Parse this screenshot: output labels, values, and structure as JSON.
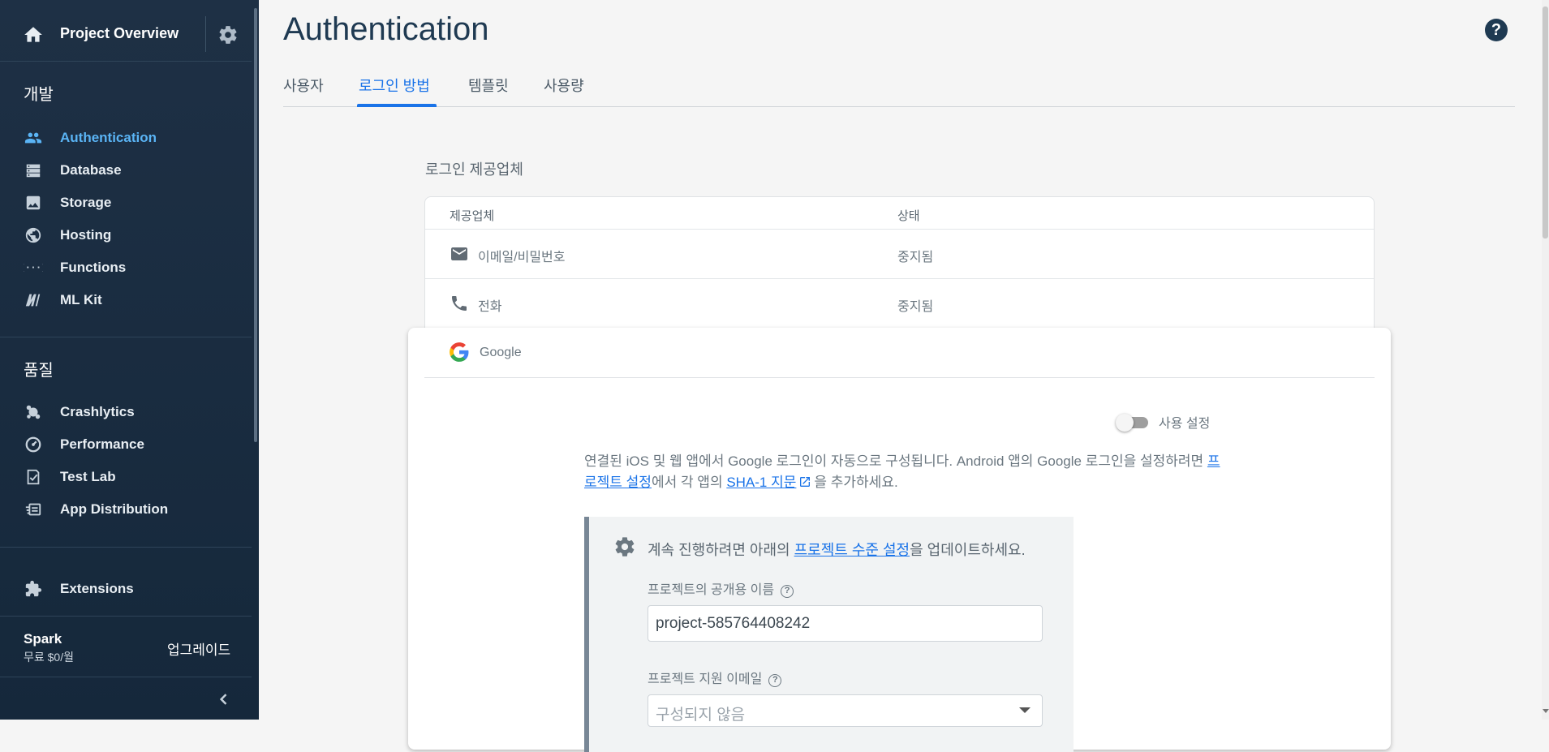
{
  "sidebar": {
    "project": "Project Overview",
    "sections": {
      "develop": "개발",
      "quality": "품질"
    },
    "develop_items": [
      {
        "label": "Authentication",
        "icon": "users-icon",
        "active": true
      },
      {
        "label": "Database",
        "icon": "database-icon"
      },
      {
        "label": "Storage",
        "icon": "image-icon"
      },
      {
        "label": "Hosting",
        "icon": "globe-icon"
      },
      {
        "label": "Functions",
        "icon": "functions-icon"
      },
      {
        "label": "ML Kit",
        "icon": "ml-kit-icon"
      }
    ],
    "quality_items": [
      {
        "label": "Crashlytics",
        "icon": "crashlytics-icon"
      },
      {
        "label": "Performance",
        "icon": "gauge-icon"
      },
      {
        "label": "Test Lab",
        "icon": "checklist-icon"
      },
      {
        "label": "App Distribution",
        "icon": "app-distribution-icon"
      }
    ],
    "extensions": "Extensions",
    "plan": {
      "name": "Spark",
      "price": "무료 $0/월",
      "upgrade": "업그레이드"
    }
  },
  "header": {
    "title": "Authentication",
    "tabs": [
      "사용자",
      "로그인 방법",
      "템플릿",
      "사용량"
    ],
    "active_tab": 1
  },
  "providers": {
    "title": "로그인 제공업체",
    "col_provider": "제공업체",
    "col_status": "상태",
    "rows": [
      {
        "name": "이메일/비밀번호",
        "status": "중지됨",
        "icon": "mail-icon"
      },
      {
        "name": "전화",
        "status": "중지됨",
        "icon": "phone-icon"
      }
    ]
  },
  "google": {
    "name": "Google",
    "enable_label": "사용 설정",
    "enabled": false,
    "desc_part1": "연결된 iOS 및 웹 앱에서 Google 로그인이 자동으로 구성됩니다. Android 앱의 Google 로그인을 설정하려면 ",
    "desc_link1": "프로젝트 설정",
    "desc_part2": "에서 각 앱의 ",
    "desc_link2": "SHA-1 지문",
    "desc_part3": "을 추가하세요.",
    "notice_part1": "계속 진행하려면 아래의 ",
    "notice_link": "프로젝트 수준 설정",
    "notice_part2": "을 업데이트하세요.",
    "public_name_label": "프로젝트의 공개용 이름",
    "public_name_value": "project-585764408242",
    "support_email_label": "프로젝트 지원 이메일",
    "support_email_placeholder": "구성되지 않음"
  },
  "colors": {
    "sidebar_bg": "#1a2b3c",
    "accent": "#1a73e8",
    "title": "#1f3a52"
  }
}
